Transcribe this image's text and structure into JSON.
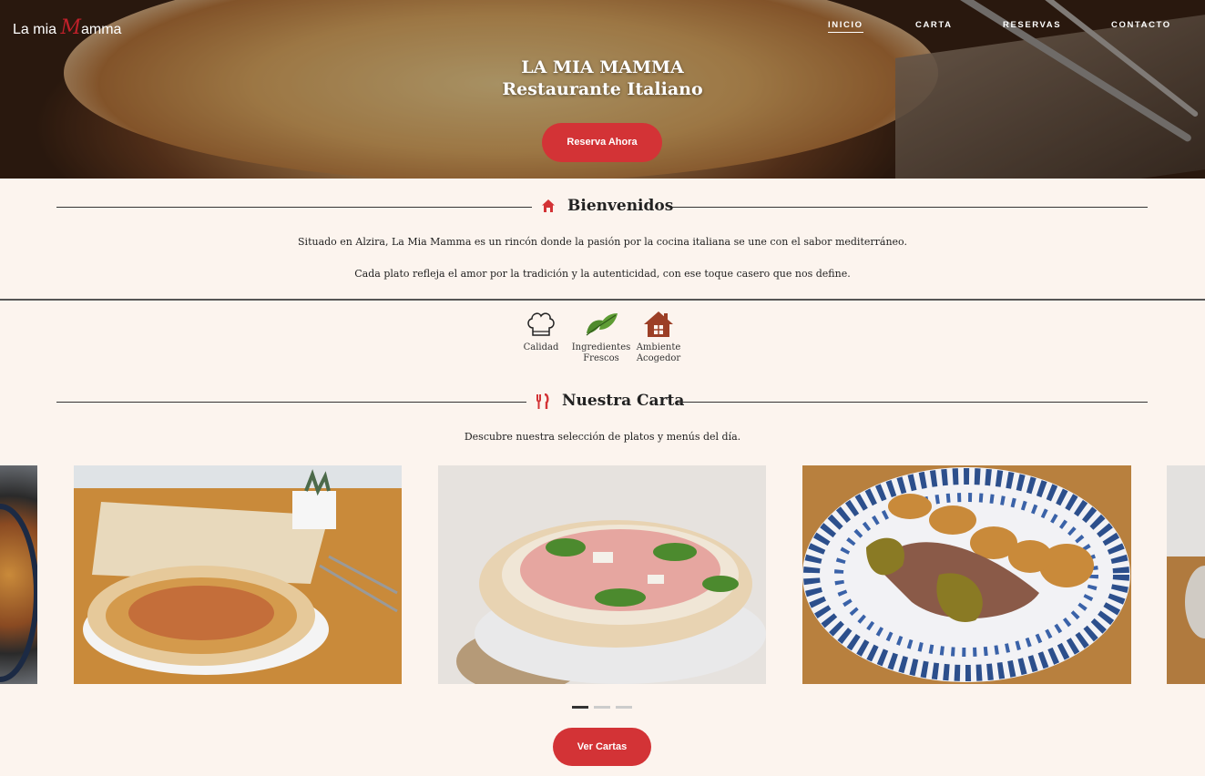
{
  "brand": {
    "logo_prefix": "La mia ",
    "logo_m": "M",
    "logo_suffix": "amma"
  },
  "nav": {
    "items": [
      "INICIO",
      "CARTA",
      "RESERVAS",
      "CONTACTO"
    ],
    "active": "INICIO"
  },
  "hero": {
    "title": "LA MIA MAMMA",
    "subtitle": "Restaurante Italiano",
    "cta": "Reserva Ahora"
  },
  "welcome": {
    "heading": "Bienvenidos",
    "icon": "home-icon",
    "p1": "Situado en Alzira, La Mia Mamma es un rincón donde la pasión por la cocina italiana se une con el sabor mediterráneo.",
    "p2": "Cada plato refleja el amor por la tradición y la autenticidad, con ese toque casero que nos define."
  },
  "features": [
    {
      "label": "Calidad",
      "icon": "chef-hat-icon"
    },
    {
      "label": "Ingredientes Frescos",
      "icon": "leaf-icon"
    },
    {
      "label": "Ambiente Acogedor",
      "icon": "house-icon"
    }
  ],
  "menu": {
    "heading": "Nuestra Carta",
    "icon": "utensils-icon",
    "desc": "Descubre nuestra selección de platos y menús del día.",
    "cards": [
      "paella-photo",
      "pizza-photo",
      "prosciutto-pizza-photo",
      "meat-dish-photo",
      "dish-photo"
    ],
    "active_dot": 0,
    "dot_count": 3,
    "cta": "Ver Cartas"
  },
  "colors": {
    "accent": "#d33336",
    "background": "#fcf4ee"
  }
}
